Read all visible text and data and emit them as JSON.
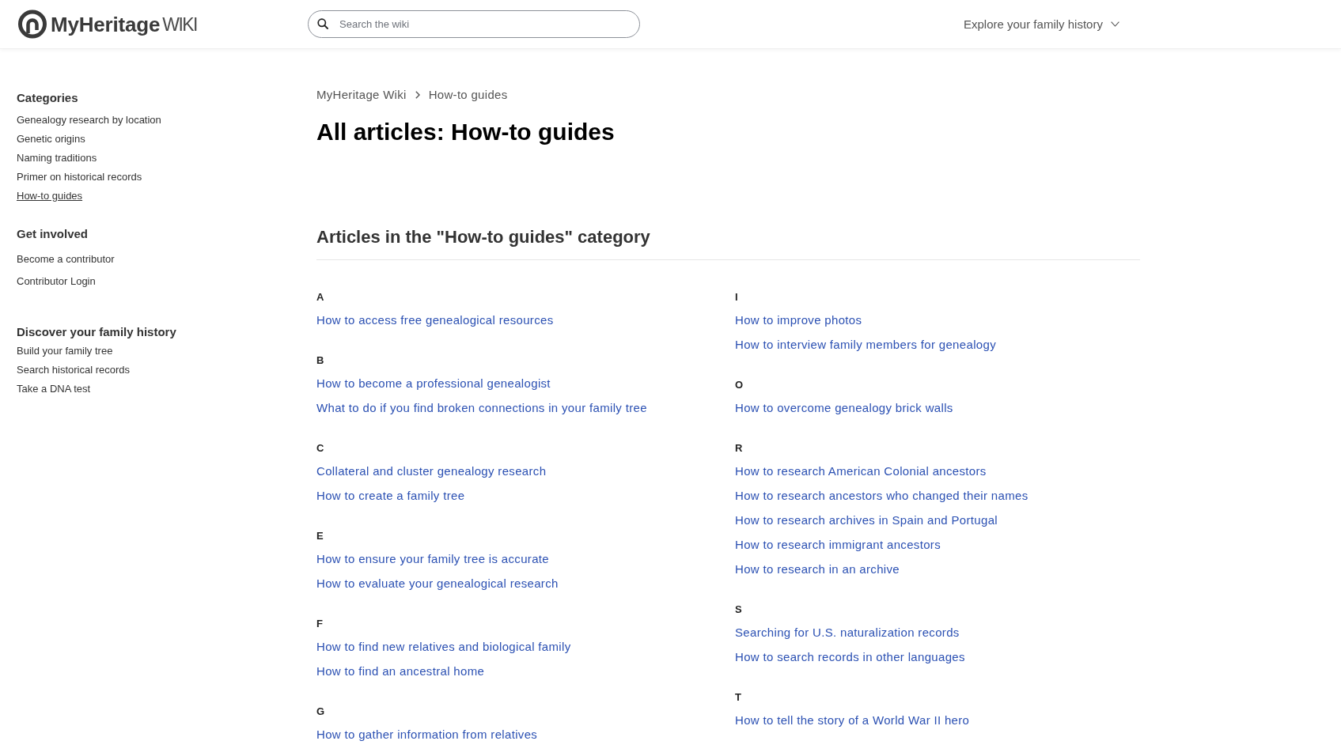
{
  "header": {
    "logo": {
      "brand": "MyHeritage",
      "suffix": "WIKI"
    },
    "search": {
      "placeholder": "Search the wiki"
    },
    "explore_menu": {
      "label": "Explore your family history"
    }
  },
  "sidebar": {
    "sections": [
      {
        "title": "Categories",
        "items": [
          {
            "label": "Genealogy research by location",
            "selected": false
          },
          {
            "label": "Genetic origins",
            "selected": false
          },
          {
            "label": "Naming traditions",
            "selected": false
          },
          {
            "label": "Primer on historical records",
            "selected": false
          },
          {
            "label": "How-to guides",
            "selected": true
          }
        ]
      },
      {
        "title": "Get involved",
        "items": [
          {
            "label": "Become a contributor"
          },
          {
            "label": "Contributor Login"
          }
        ]
      },
      {
        "title": "Discover your family history",
        "items": [
          {
            "label": "Build your family tree"
          },
          {
            "label": "Search historical records"
          },
          {
            "label": "Take a DNA test"
          }
        ]
      }
    ]
  },
  "breadcrumb": [
    "MyHeritage Wiki",
    "How-to guides"
  ],
  "title": "All articles: How-to guides",
  "section_heading": "Articles in the \"How-to guides\" category",
  "columns": [
    {
      "groups": [
        {
          "letter": "A",
          "links": [
            "How to access free genealogical resources"
          ]
        },
        {
          "letter": "B",
          "links": [
            "How to become a professional genealogist",
            "What to do if you find broken connections in your family tree"
          ]
        },
        {
          "letter": "C",
          "links": [
            "Collateral and cluster genealogy research",
            "How to create a family tree"
          ]
        },
        {
          "letter": "E",
          "links": [
            "How to ensure your family tree is accurate",
            "How to evaluate your genealogical research"
          ]
        },
        {
          "letter": "F",
          "links": [
            "How to find new relatives and biological family",
            "How to find an ancestral home"
          ]
        },
        {
          "letter": "G",
          "links": [
            "How to gather information from relatives"
          ]
        }
      ]
    },
    {
      "groups": [
        {
          "letter": "I",
          "links": [
            "How to improve photos",
            "How to interview family members for genealogy"
          ]
        },
        {
          "letter": "O",
          "links": [
            "How to overcome genealogy brick walls"
          ]
        },
        {
          "letter": "R",
          "links": [
            "How to research American Colonial ancestors",
            "How to research ancestors who changed their names",
            "How to research archives in Spain and Portugal",
            "How to research immigrant ancestors",
            "How to research in an archive"
          ]
        },
        {
          "letter": "S",
          "links": [
            "Searching for U.S. naturalization records",
            "How to search records in other languages"
          ]
        },
        {
          "letter": "T",
          "links": [
            "How to tell the story of a World War II hero"
          ]
        }
      ]
    }
  ]
}
